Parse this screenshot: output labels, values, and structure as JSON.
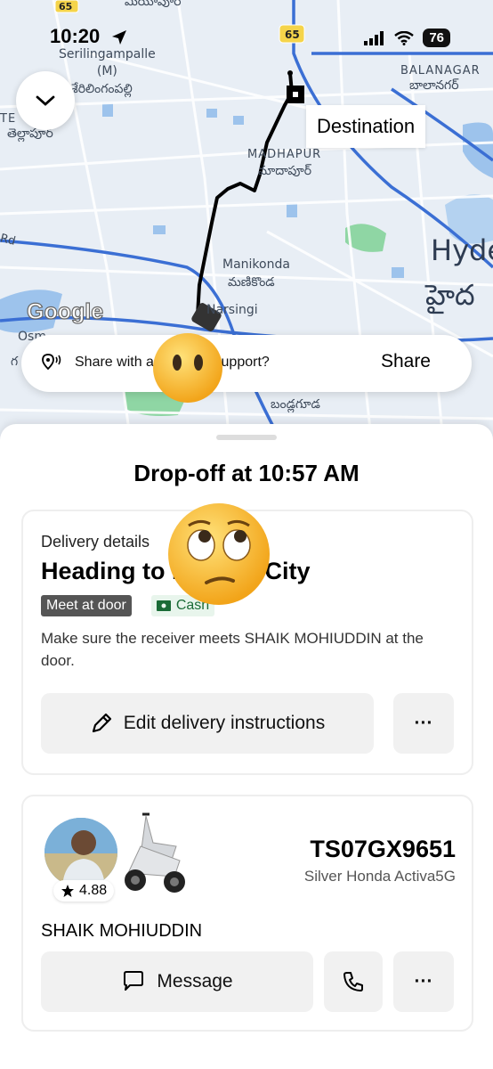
{
  "status_bar": {
    "time": "10:20",
    "battery": "76"
  },
  "map": {
    "labels": {
      "serilingampalle": "Serilingampalle\n(M)",
      "serilingampalle_te": "శేరిలింగంపల్లి",
      "top_te": "మియాపూర్",
      "balanagar": "BALANAGAR",
      "balanagar_te": "బాలానగర్",
      "tellapur_en": "TE",
      "tellapur_te": "తెల్లాపూర్",
      "madhapur": "MADHAPUR",
      "madhapur_te": "మాదాపూర్",
      "manikonda": "Manikonda",
      "manikonda_te": "మణికొండ",
      "narsingi": "Narsingi",
      "hyd": "Hyde",
      "hyd_te": "హైద",
      "osman": "Osm",
      "osman_te": "గ",
      "bandlaguda_te": "బండ్లగూడ",
      "route_shield_1": "65",
      "route_shield_2": "65",
      "road_rd": "Rd"
    },
    "destination_label": "Destination",
    "attribution": "Google"
  },
  "share_bar": {
    "text": "Share with a friend or support?",
    "button": "Share"
  },
  "sheet": {
    "dropoff_title": "Drop-off at 10:57 AM",
    "delivery": {
      "label": "Delivery details",
      "heading": "Heading to Hi-Tech City",
      "badge_meet": "Meet at door",
      "badge_cash": "Cash",
      "description": "Make sure the receiver meets SHAIK MOHIUDDIN at the door.",
      "edit_button": "Edit delivery instructions",
      "more": "···"
    },
    "driver": {
      "plate": "TS07GX9651",
      "vehicle": "Silver Honda Activa5G",
      "rating": "4.88",
      "name": "SHAIK MOHIUDDIN",
      "message_button": "Message",
      "more": "···"
    }
  },
  "colors": {
    "map_bg": "#e8eef5",
    "road": "#c9d3e0",
    "highway": "#3b6fd4",
    "water": "#9dc3ec",
    "park": "#8fd6a4",
    "route": "#000000"
  }
}
